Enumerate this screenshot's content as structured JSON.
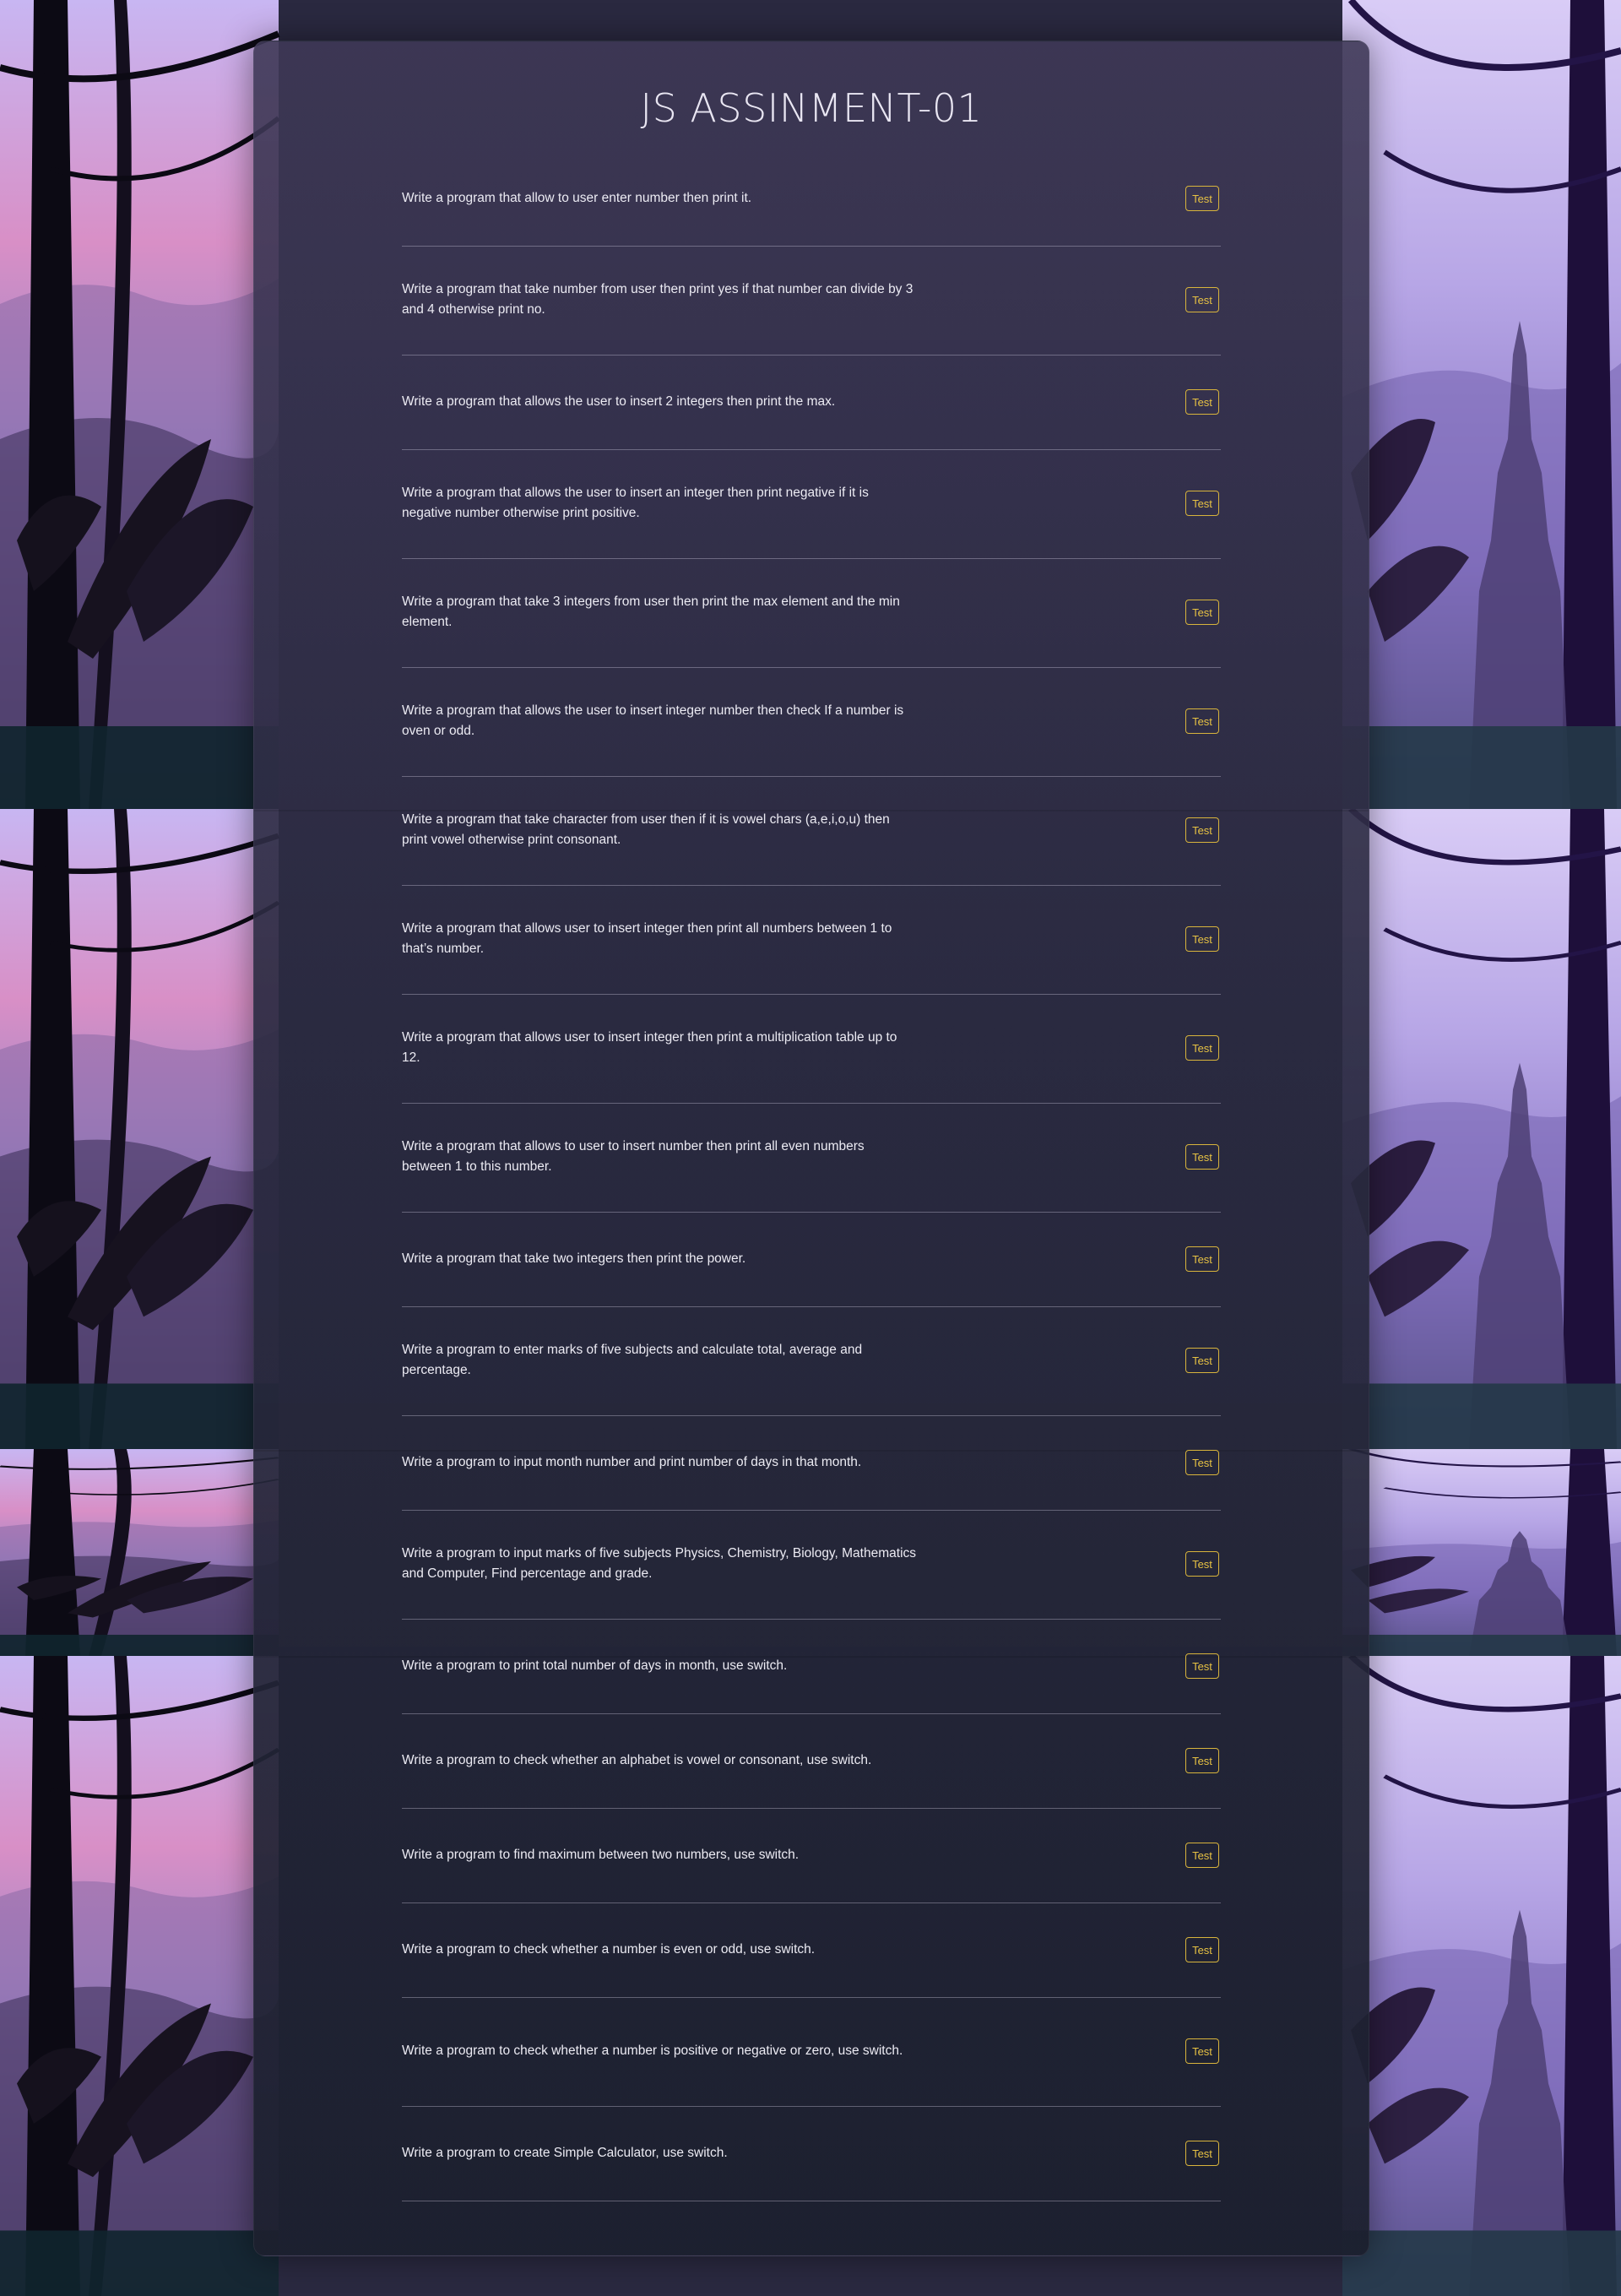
{
  "page": {
    "title": "JS ASSINMENT-01"
  },
  "theme": {
    "button_color": "#d8b43c",
    "card_color": "#2e2d44",
    "sky_top": "#c8b4f0",
    "sky_pink": "#d88fc6"
  },
  "exercises": [
    {
      "question": "Write a program that allow to user enter number then print it.",
      "button": "Test"
    },
    {
      "question": "Write a program that take number from user then print yes if that number can divide by 3 and 4 otherwise print no.",
      "button": "Test"
    },
    {
      "question": "Write a program that allows the user to insert 2 integers then print the max.",
      "button": "Test"
    },
    {
      "question": "Write a program that allows the user to insert an integer then print negative if it is negative number otherwise print positive.",
      "button": "Test"
    },
    {
      "question": "Write a program that take 3 integers from user then print the max element and the min element.",
      "button": "Test"
    },
    {
      "question": "Write a program that allows the user to insert integer number then check If a number is oven or odd.",
      "button": "Test"
    },
    {
      "question": "Write a program that take character from user then if it is vowel chars (a,e,i,o,u) then print vowel otherwise print consonant.",
      "button": "Test"
    },
    {
      "question": "Write a program that allows user to insert integer then print all numbers between 1 to that’s number.",
      "button": "Test"
    },
    {
      "question": "Write a program that allows user to insert integer then print a multiplication table up to 12.",
      "button": "Test"
    },
    {
      "question": "Write a program that allows to user to insert number then print all even numbers between 1 to this number.",
      "button": "Test"
    },
    {
      "question": "Write a program that take two integers then print the power.",
      "button": "Test"
    },
    {
      "question": "Write a program to enter marks of five subjects and calculate total, average and percentage.",
      "button": "Test"
    },
    {
      "question": "Write a program to input month number and print number of days in that month.",
      "button": "Test"
    },
    {
      "question": "Write a program to input marks of five subjects Physics, Chemistry, Biology, Mathematics and Computer, Find percentage and grade.",
      "button": "Test"
    },
    {
      "question": "Write a program to print total number of days in month, use switch.",
      "button": "Test"
    },
    {
      "question": "Write a program to check whether an alphabet is vowel or consonant, use switch.",
      "button": "Test"
    },
    {
      "question": "Write a program to find maximum between two numbers, use switch.",
      "button": "Test"
    },
    {
      "question": "Write a program to check whether a number is even or odd, use switch.",
      "button": "Test"
    },
    {
      "question": "Write a program to check whether a number is positive or negative or zero, use switch.",
      "button": "Test"
    },
    {
      "question": "Write a program to create Simple Calculator, use switch.",
      "button": "Test"
    }
  ]
}
